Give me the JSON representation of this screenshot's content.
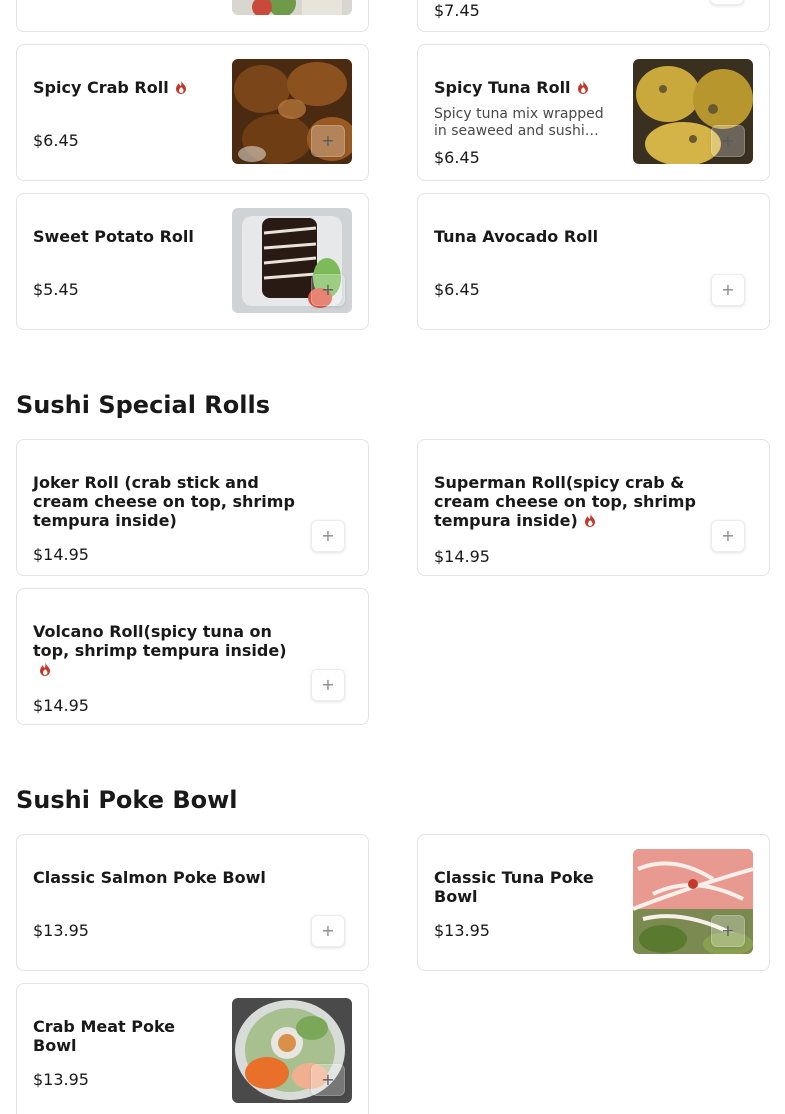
{
  "top_partial": {
    "left_card": {},
    "right_card": {
      "price": "$7.45"
    }
  },
  "cards_a": [
    {
      "name": "Spicy Crab Roll",
      "spicy": true,
      "price": "$6.45"
    },
    {
      "name": "Spicy Tuna Roll",
      "spicy": true,
      "description": "Spicy tuna mix wrapped in seaweed and sushi…",
      "price": "$6.45"
    },
    {
      "name": "Sweet Potato Roll",
      "spicy": false,
      "price": "$5.45"
    },
    {
      "name": "Tuna Avocado Roll",
      "spicy": false,
      "price": "$6.45"
    }
  ],
  "sections": {
    "special": {
      "title": "Sushi Special Rolls",
      "items": [
        {
          "name": "Joker Roll (crab stick and cream cheese on top, shrimp tempura inside)",
          "spicy": false,
          "price": "$14.95"
        },
        {
          "name": "Superman Roll(spicy crab & cream cheese on top, shrimp tempura inside)",
          "spicy": true,
          "price": "$14.95"
        },
        {
          "name": "Volcano Roll(spicy tuna on top, shrimp tempura inside)",
          "spicy": true,
          "price": "$14.95"
        }
      ]
    },
    "poke": {
      "title": "Sushi Poke Bowl",
      "items": [
        {
          "name": "Classic Salmon Poke Bowl",
          "price": "$13.95"
        },
        {
          "name": "Classic Tuna Poke Bowl",
          "price": "$13.95"
        },
        {
          "name": "Crab Meat Poke Bowl",
          "price": "$13.95"
        }
      ]
    }
  },
  "icons": {
    "add": "plus-icon",
    "spicy": "flame-icon"
  },
  "colors": {
    "spicy": "#c0392b",
    "border": "#e3e3e3",
    "text": "#191919"
  },
  "add_symbol": "+"
}
